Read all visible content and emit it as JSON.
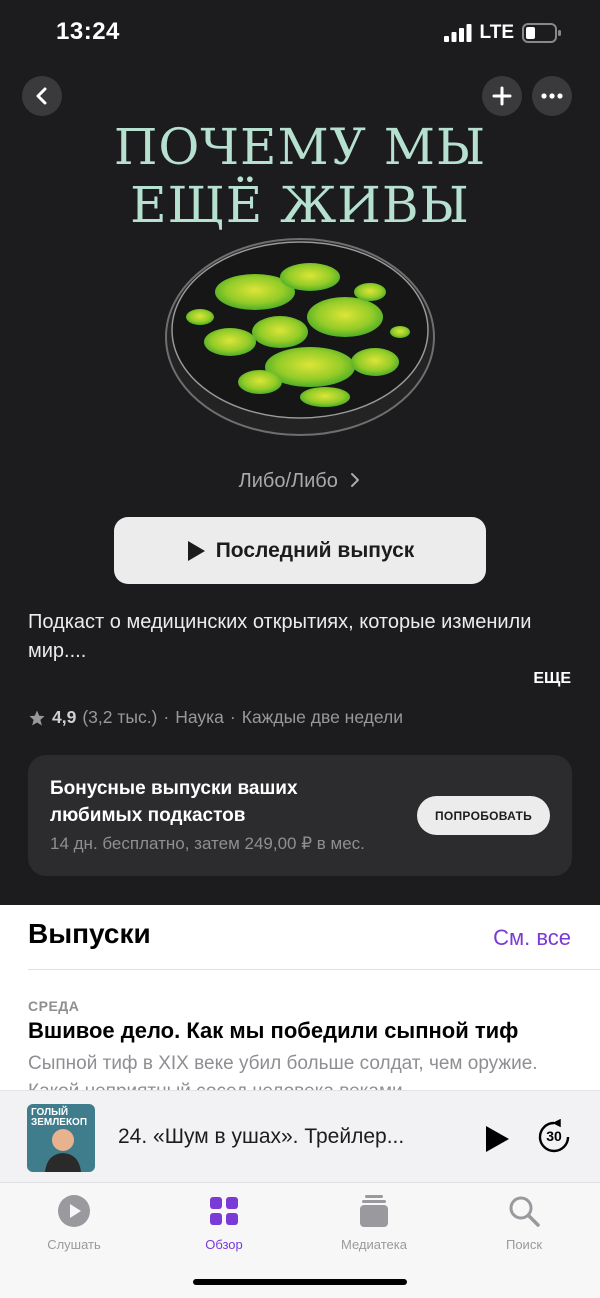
{
  "status_bar": {
    "time": "13:24",
    "network": "LTE"
  },
  "header": {
    "back_icon": "chevron-left-icon",
    "add_icon": "plus-icon",
    "more_icon": "ellipsis-icon"
  },
  "podcast": {
    "art_title_line1": "ПОЧЕМУ МЫ",
    "art_title_line2": "ЕЩЁ ЖИВЫ",
    "author": "Либо/Либо",
    "latest_button": "Последний выпуск",
    "description": "Подкаст о медицинских открытиях, которые изменили мир....",
    "more_label": "ЕЩЕ",
    "rating": "4,9",
    "rating_count": "(3,2 тыс.)",
    "category": "Наука",
    "frequency": "Каждые две недели"
  },
  "promo": {
    "title": "Бонусные выпуски ваших любимых подкастов",
    "subtitle": "14 дн. бесплатно, затем 249,00 ₽ в мес.",
    "button": "ПОПРОБОВАТЬ"
  },
  "episodes": {
    "section_title": "Выпуски",
    "see_all": "См. все",
    "items": [
      {
        "day": "СРЕДА",
        "title": "Вшивое дело. Как мы победили сыпной тиф",
        "description": "Сыпной тиф в XIX веке убил больше солдат, чем оружие. Какой неприятный сосед человека веками"
      }
    ]
  },
  "mini_player": {
    "cover_text": "ГОЛЫЙ ЗЕМЛЕКОП",
    "title": "24. «Шум в ушах». Трейлер...",
    "skip_label": "30"
  },
  "tabs": [
    {
      "label": "Слушать",
      "icon": "play-circle-icon",
      "active": false
    },
    {
      "label": "Обзор",
      "icon": "grid-icon",
      "active": true
    },
    {
      "label": "Медиатека",
      "icon": "library-icon",
      "active": false
    },
    {
      "label": "Поиск",
      "icon": "search-icon",
      "active": false
    }
  ],
  "colors": {
    "accent": "#7a3ad6",
    "art_title": "#b6e0d0",
    "background": "#1c1c1e"
  }
}
